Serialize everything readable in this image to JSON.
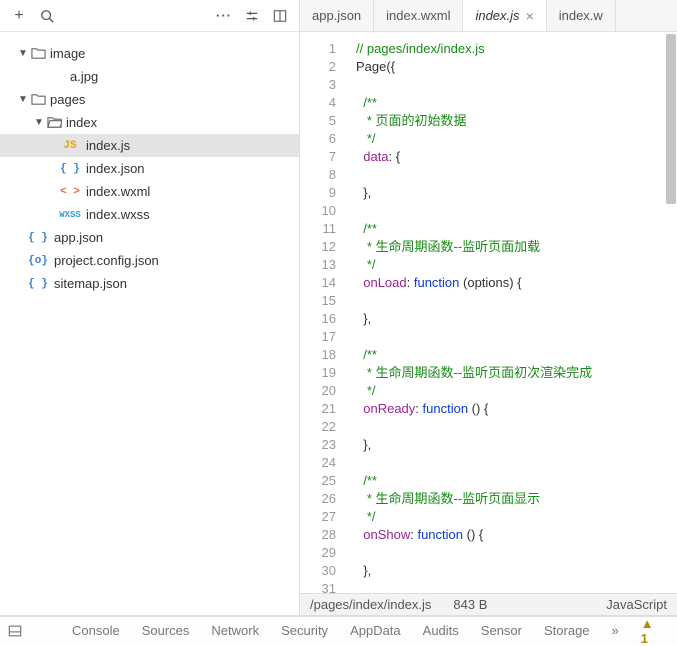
{
  "toolbar": {
    "add": "+",
    "search": "",
    "more": "···"
  },
  "tree": [
    {
      "depth": 0,
      "arrow": "▼",
      "kind": "folder",
      "label": "image"
    },
    {
      "depth": 1,
      "arrow": "",
      "kind": "file",
      "icon": "jpg",
      "label": "a.jpg"
    },
    {
      "depth": 0,
      "arrow": "▼",
      "kind": "folder",
      "label": "pages"
    },
    {
      "depth": 1,
      "arrow": "▼",
      "kind": "folder-open",
      "label": "index"
    },
    {
      "depth": 2,
      "arrow": "",
      "kind": "file",
      "icon": "js",
      "label": "index.js",
      "selected": true
    },
    {
      "depth": 2,
      "arrow": "",
      "kind": "file",
      "icon": "json",
      "label": "index.json"
    },
    {
      "depth": 2,
      "arrow": "",
      "kind": "file",
      "icon": "wxml",
      "label": "index.wxml"
    },
    {
      "depth": 2,
      "arrow": "",
      "kind": "file",
      "icon": "wxss",
      "label": "index.wxss"
    },
    {
      "depth": 0,
      "arrow": "",
      "kind": "file",
      "icon": "json",
      "label": "app.json"
    },
    {
      "depth": 0,
      "arrow": "",
      "kind": "file",
      "icon": "cfg",
      "label": "project.config.json"
    },
    {
      "depth": 0,
      "arrow": "",
      "kind": "file",
      "icon": "json",
      "label": "sitemap.json"
    }
  ],
  "tabs": [
    {
      "label": "app.json",
      "active": false
    },
    {
      "label": "index.wxml",
      "active": false
    },
    {
      "label": "index.js",
      "active": true,
      "closable": true
    },
    {
      "label": "index.w",
      "active": false
    }
  ],
  "code": [
    [
      {
        "c": "c-com",
        "t": "// pages/index/index.js"
      }
    ],
    [
      {
        "c": "c-call",
        "t": "Page"
      },
      {
        "c": "",
        "t": "({"
      }
    ],
    [],
    [
      {
        "c": "",
        "t": "  "
      },
      {
        "c": "c-com",
        "t": "/**"
      }
    ],
    [
      {
        "c": "",
        "t": "  "
      },
      {
        "c": "c-com",
        "t": " * 页面的初始数据"
      }
    ],
    [
      {
        "c": "",
        "t": "  "
      },
      {
        "c": "c-com",
        "t": " */"
      }
    ],
    [
      {
        "c": "",
        "t": "  "
      },
      {
        "c": "c-key",
        "t": "data"
      },
      {
        "c": "",
        "t": ": {"
      }
    ],
    [],
    [
      {
        "c": "",
        "t": "  },"
      }
    ],
    [],
    [
      {
        "c": "",
        "t": "  "
      },
      {
        "c": "c-com",
        "t": "/**"
      }
    ],
    [
      {
        "c": "",
        "t": "  "
      },
      {
        "c": "c-com",
        "t": " * 生命周期函数--监听页面加载"
      }
    ],
    [
      {
        "c": "",
        "t": "  "
      },
      {
        "c": "c-com",
        "t": " */"
      }
    ],
    [
      {
        "c": "",
        "t": "  "
      },
      {
        "c": "c-key",
        "t": "onLoad"
      },
      {
        "c": "",
        "t": ": "
      },
      {
        "c": "c-kw",
        "t": "function"
      },
      {
        "c": "",
        "t": " (options) {"
      }
    ],
    [],
    [
      {
        "c": "",
        "t": "  },"
      }
    ],
    [],
    [
      {
        "c": "",
        "t": "  "
      },
      {
        "c": "c-com",
        "t": "/**"
      }
    ],
    [
      {
        "c": "",
        "t": "  "
      },
      {
        "c": "c-com",
        "t": " * 生命周期函数--监听页面初次渲染完成"
      }
    ],
    [
      {
        "c": "",
        "t": "  "
      },
      {
        "c": "c-com",
        "t": " */"
      }
    ],
    [
      {
        "c": "",
        "t": "  "
      },
      {
        "c": "c-key",
        "t": "onReady"
      },
      {
        "c": "",
        "t": ": "
      },
      {
        "c": "c-kw",
        "t": "function"
      },
      {
        "c": "",
        "t": " () {"
      }
    ],
    [],
    [
      {
        "c": "",
        "t": "  },"
      }
    ],
    [],
    [
      {
        "c": "",
        "t": "  "
      },
      {
        "c": "c-com",
        "t": "/**"
      }
    ],
    [
      {
        "c": "",
        "t": "  "
      },
      {
        "c": "c-com",
        "t": " * 生命周期函数--监听页面显示"
      }
    ],
    [
      {
        "c": "",
        "t": "  "
      },
      {
        "c": "c-com",
        "t": " */"
      }
    ],
    [
      {
        "c": "",
        "t": "  "
      },
      {
        "c": "c-key",
        "t": "onShow"
      },
      {
        "c": "",
        "t": ": "
      },
      {
        "c": "c-kw",
        "t": "function"
      },
      {
        "c": "",
        "t": " () {"
      }
    ],
    [],
    [
      {
        "c": "",
        "t": "  },"
      }
    ],
    []
  ],
  "status": {
    "path": "/pages/index/index.js",
    "size": "843 B",
    "lang": "JavaScript"
  },
  "bottom": {
    "items": [
      "Console",
      "Sources",
      "Network",
      "Security",
      "AppData",
      "Audits",
      "Sensor",
      "Storage"
    ],
    "overflow": "»",
    "warn": "▲ 1"
  }
}
